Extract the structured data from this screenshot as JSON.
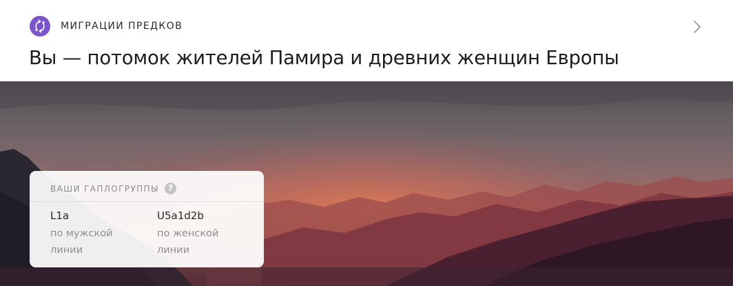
{
  "header": {
    "category_icon": "migration-arrows-icon",
    "category": "МИГРАЦИИ ПРЕДКОВ",
    "title": "Вы — потомок жителей Памира и древних женщин Европы",
    "chevron_icon": "chevron-right-icon"
  },
  "hero": {
    "image": "mountain-sunset-landscape"
  },
  "haplogroups": {
    "label": "ВАШИ ГАПЛОГРУППЫ",
    "help_icon": "question-icon",
    "help_glyph": "?",
    "items": [
      {
        "value": "L1a",
        "description": "по мужской линии"
      },
      {
        "value": "U5a1d2b",
        "description": "по женской линии"
      }
    ]
  },
  "colors": {
    "accent": "#7b55c9",
    "text": "#1c1c1c",
    "muted": "#8f8f8f"
  }
}
